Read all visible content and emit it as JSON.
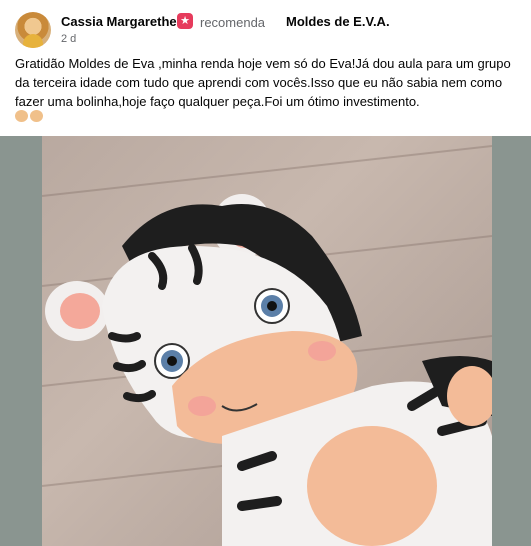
{
  "post": {
    "author": "Cassia Margarethe",
    "recommends_label": "recomenda",
    "page_name": "Moldes de E.V.A.",
    "time": "2 d",
    "text": "Gratidão Moldes de Eva ,minha renda hoje vem só do Eva!Já dou aula para um grupo da terceira idade com tudo que aprendi com vocês.Isso que eu não sabia nem como fazer uma bolinha,hoje faço qualquer peça.Foi um ótimo investimento.",
    "icons": {
      "recommend": "recommend-star-icon",
      "emoji": "clapping-hands-icon"
    }
  },
  "colors": {
    "recommend_badge": "#e63b5c",
    "secondary_text": "#65676b"
  }
}
